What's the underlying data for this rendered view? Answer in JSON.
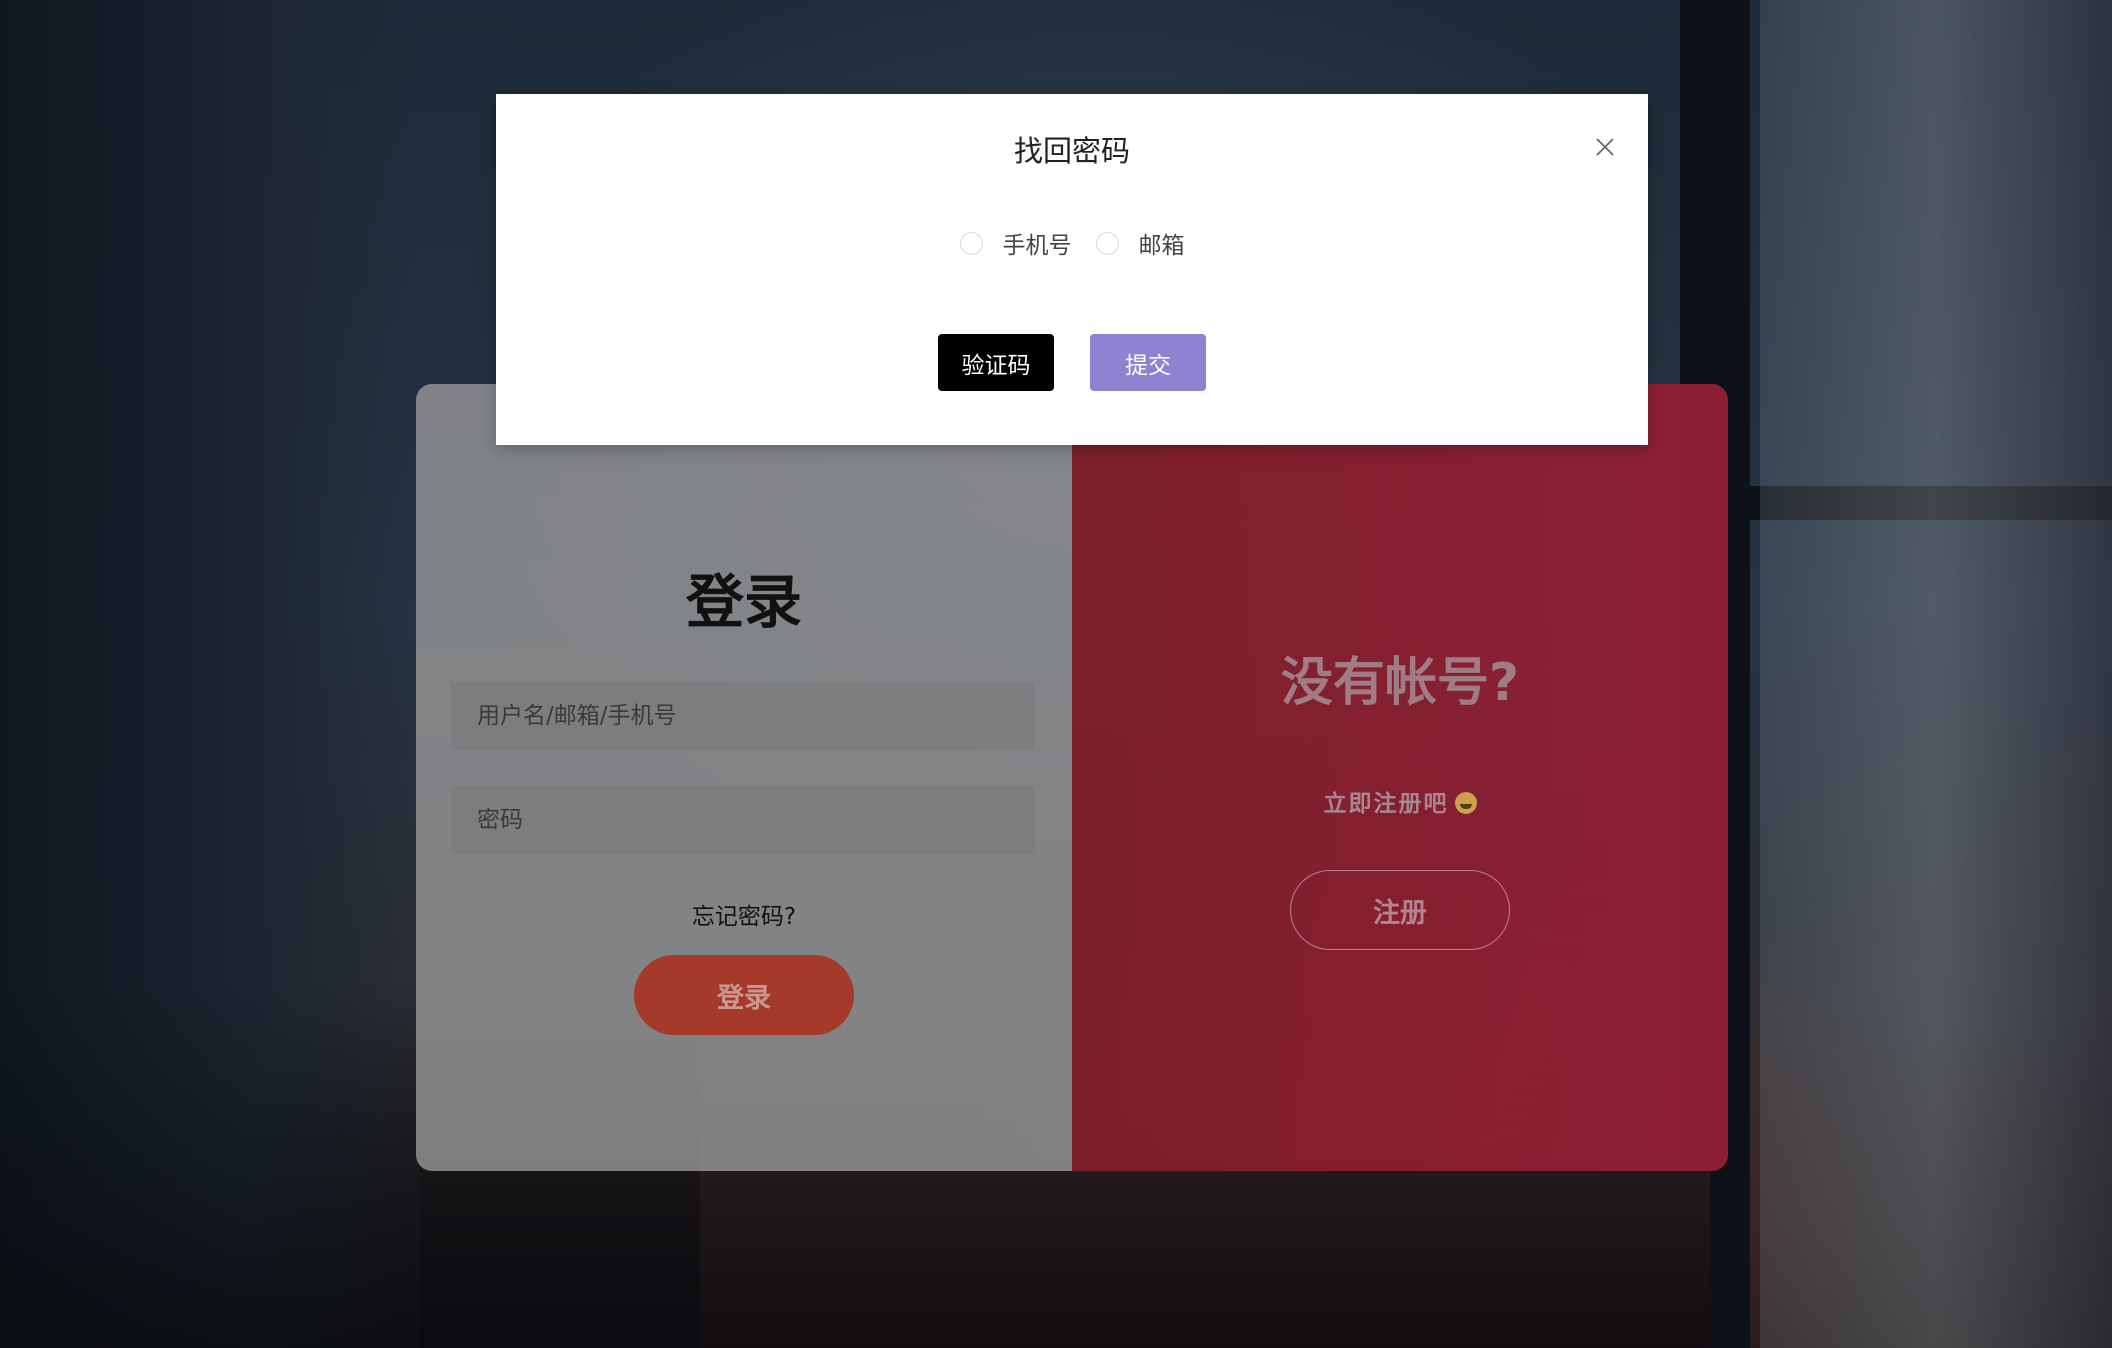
{
  "modal": {
    "title": "找回密码",
    "options": [
      {
        "label": "手机号",
        "selected": false
      },
      {
        "label": "邮箱",
        "selected": false
      }
    ],
    "send_code_label": "验证码",
    "submit_label": "提交",
    "close_icon": "close-icon"
  },
  "login": {
    "title": "登录",
    "username_placeholder": "用户名/邮箱/手机号",
    "password_placeholder": "密码",
    "forgot_label": "忘记密码?",
    "login_button_label": "登录"
  },
  "register": {
    "title": "没有帐号?",
    "subtitle": "立即注册吧",
    "emoji_icon": "smile-emoji-icon",
    "register_button_label": "注册"
  },
  "colors": {
    "login_button": "#a53a2a",
    "submit_button": "#8f82d1",
    "register_panel": "#8c1e33",
    "code_button": "#000000"
  }
}
